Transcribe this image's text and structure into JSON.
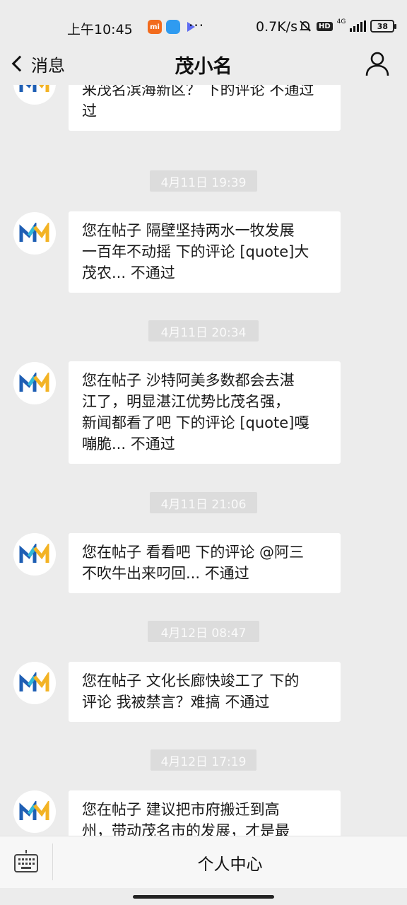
{
  "status_bar": {
    "time": "上午10:45",
    "dots": "···",
    "speed": "0.7K/s",
    "network": "4G",
    "hd": "HD",
    "battery": "38",
    "mi_label": "mi"
  },
  "nav": {
    "back_label": "消息",
    "title": "茂小名"
  },
  "messages": [
    {
      "time": "",
      "text": "您在帖子 茂名市民为何不愿意来茂名滨海新区？ 下的评论 不通过",
      "lines": [
        "来茂名滨海新区？ 下的评论 不通过",
        "过"
      ]
    },
    {
      "time": "4月11日 19:39",
      "lines": [
        "您在帖子 隔壁坚持两水一牧发展",
        "一百年不动摇 下的评论 [quote]大",
        "茂农... 不通过"
      ]
    },
    {
      "time": "4月11日 20:34",
      "lines": [
        "您在帖子 沙特阿美多数都会去湛",
        "江了，明显湛江优势比茂名强，",
        "新闻都看了吧 下的评论 [quote]嘎",
        "嘣脆... 不通过"
      ]
    },
    {
      "time": "4月11日 21:06",
      "lines": [
        "您在帖子 看看吧 下的评论 @阿三",
        "不吹牛出来叼回... 不通过"
      ]
    },
    {
      "time": "4月12日 08:47",
      "lines": [
        "您在帖子 文化长廊快竣工了 下的",
        "评论 我被禁言？难搞 不通过"
      ]
    },
    {
      "time": "4月12日 17:19",
      "lines": [
        "您在帖子 建议把市府搬迁到高",
        "州，带动茂名市的发展，才是最"
      ]
    }
  ],
  "bottom": {
    "menu_label": "个人中心"
  },
  "colors": {
    "background": "#ececec",
    "bubble": "#ffffff",
    "time_chip": "#dcdcdc",
    "logo_blue": "#1f5fb4",
    "logo_cyan": "#2fb8d8",
    "logo_yellow": "#f3b324"
  }
}
